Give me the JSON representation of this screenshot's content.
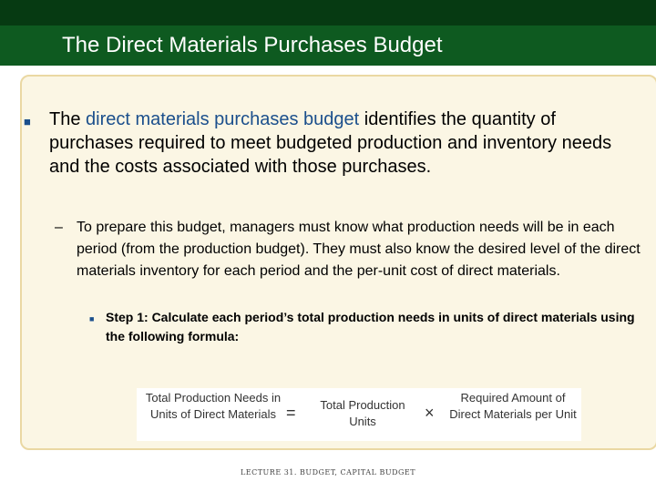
{
  "slide": {
    "title": "The Direct Materials Purchases Budget",
    "bullet1": {
      "prefix": "The ",
      "highlight": "direct materials purchases budget",
      "suffix": " identifies the quantity of purchases required to meet budgeted production and inventory needs and the costs associated with those purchases."
    },
    "bullet2": "To prepare this budget, managers must know what production needs will be in each period (from the production budget). They must also know the desired level of the direct materials inventory for each period and the per-unit cost of direct materials.",
    "bullet3": "Step 1: Calculate each period’s total production needs in units of direct materials using the following formula:",
    "formula": {
      "term1": "Total Production Needs in Units of Direct Materials",
      "equals": "=",
      "term2": "Total Production Units",
      "times": "×",
      "term3": "Required Amount of Direct Materials per Unit"
    },
    "footer": "LECTURE 31. BUDGET, CAPITAL BUDGET"
  },
  "colors": {
    "title_bar": "#0e5a20",
    "top_strip": "#063a12",
    "card_background": "#fbf6e4",
    "card_border": "#ead8a3",
    "highlight_text": "#1b4f8c"
  },
  "icons": {
    "bullet_marker": "square-bullet-icon"
  }
}
